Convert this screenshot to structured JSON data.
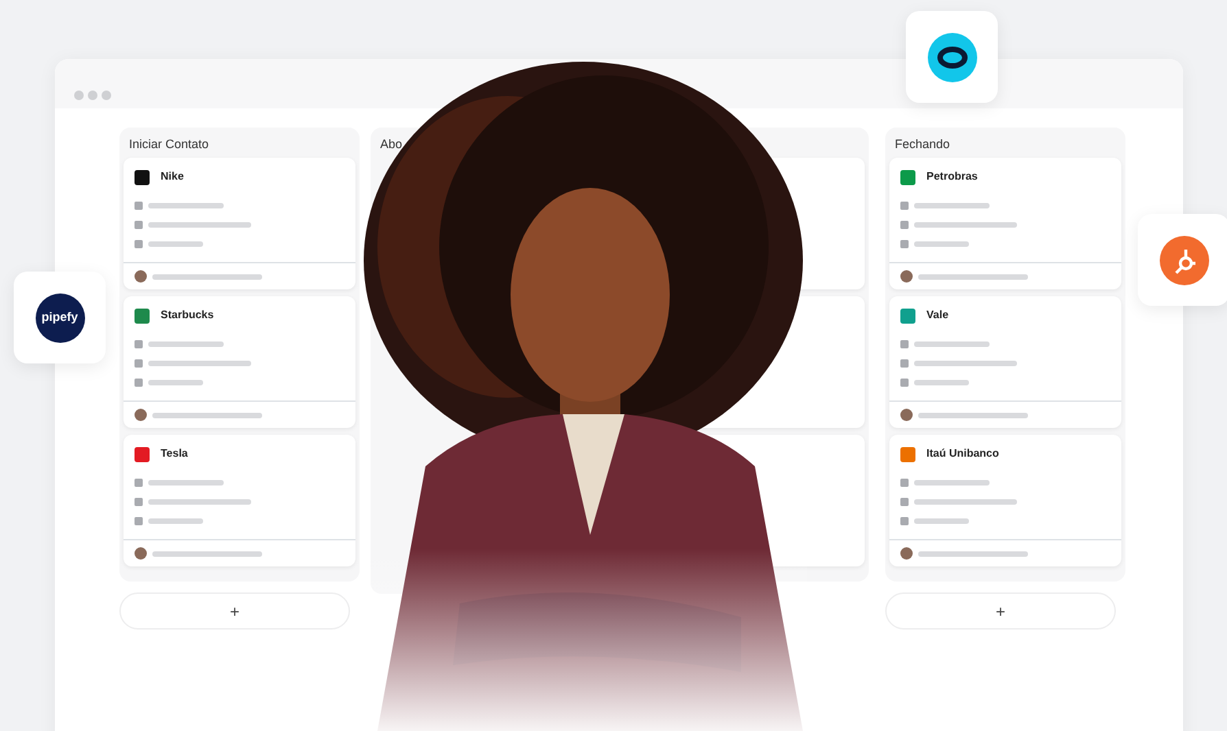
{
  "floating_logos": [
    {
      "kind": "ring",
      "color": "#12c6ea"
    },
    {
      "kind": "wordmark",
      "label": "pipefy",
      "color": "#0d1d4f"
    },
    {
      "kind": "sprocket",
      "color": "#f26b2e"
    }
  ],
  "columns": [
    {
      "title": "Iniciar Contato",
      "add_label": "+",
      "cards": [
        {
          "kind": "company",
          "name": "Nike",
          "color": "#111111"
        },
        {
          "kind": "company",
          "name": "Starbucks",
          "color": "#1e8a4c"
        },
        {
          "kind": "company",
          "name": "Tesla",
          "color": "#e31b23"
        }
      ]
    },
    {
      "title": "Abo"
    },
    {
      "cards": [
        {
          "kind": "blank"
        },
        {
          "kind": "blank"
        },
        {
          "kind": "blank"
        }
      ]
    },
    {
      "title": "Fechando",
      "add_label": "+",
      "cards": [
        {
          "kind": "company",
          "name": "Petrobras",
          "color": "#0c9a4a"
        },
        {
          "kind": "company",
          "name": "Vale",
          "color": "#10a08e"
        },
        {
          "kind": "company",
          "name": "Itaú Unibanco",
          "color": "#ec7000"
        }
      ]
    }
  ]
}
